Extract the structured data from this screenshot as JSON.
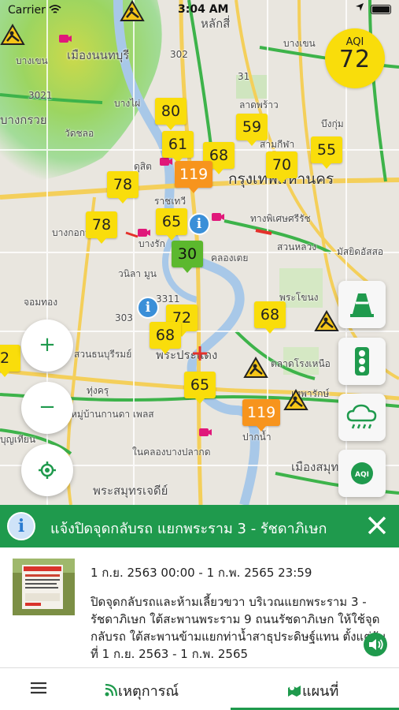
{
  "status_bar": {
    "carrier": "Carrier",
    "time": "3:04 AM"
  },
  "aqi_overall": {
    "label": "AQI",
    "value": "72",
    "color": "#f9dd0b"
  },
  "aqi_markers": [
    "80",
    "59",
    "61",
    "68",
    "55",
    "70",
    "119",
    "78",
    "65",
    "78",
    "30",
    "72",
    "68",
    "68",
    "65",
    "119"
  ],
  "map_labels": {
    "area_1": "หลักสี่",
    "area_2": "เมืองนนทบุรี",
    "area_3": "บางเขน",
    "area_4": "บางกรวย",
    "area_5": "วัดชลอ",
    "area_6": "บางไผ่",
    "area_7": "ลาดพร้าว",
    "area_8": "บึงกุ่ม",
    "area_9": "สามกีฬา",
    "area_10": "ดุสิต",
    "area_11": "กรุงเทพมหานคร",
    "area_12": "ราชเทวี",
    "area_13": "บางกอกน้อย",
    "area_14": "สวนหลวง",
    "area_15": "มัสยิดอัสสอ",
    "area_16": "คลองเตย",
    "area_17": "วนิลา มูน",
    "area_18": "บางรัก",
    "area_19": "พระโขนง",
    "area_20": "จอมทอง",
    "area_21": "สวนธนบุรีรมย์",
    "area_22": "พระประแดง",
    "area_23": "ตลาดโรงเหนือ",
    "area_24": "ทุ่งครุ",
    "area_25": "หมู่บ้านกานดา เพลส",
    "area_26": "บุญเทียน",
    "area_27": "ในคลองบางปลากด",
    "area_28": "ปากน้ำ",
    "area_29": "เมืองสมุทร",
    "area_30": "พระสมุทรเจดีย์",
    "area_31": "ทางพิเศษศรีรัช",
    "area_32": "เทพารักษ์",
    "road_1": "3021",
    "road_2": "302",
    "road_3": "3311",
    "road_4": "303",
    "road_5": "31"
  },
  "map_controls": {
    "zoom_in": "+",
    "zoom_out": "−"
  },
  "banner": {
    "title": "แจ้งปิดจุดกลับรถ แยกพระราม 3 - รัชดาภิเษก"
  },
  "details": {
    "date_range": "1 ก.ย. 2563 00:00 - 1 ก.พ. 2565 23:59",
    "description": "ปิดจุดกลับรถและห้ามเลี้ยวขวา บริเวณแยกพระราม 3 - รัชดาภิเษก ใต้สะพานพระราม 9 ถนนรัชดาภิเษก ให้ใช้จุดกลับรถ ใต้สะพานข้ามแยกท่าน้ำสาธุประดิษฐ์แทน ตั้งแต่วันที่ 1 ก.ย. 2563 - 1 ก.พ. 2565"
  },
  "tabs": {
    "events": "เหตุการณ์",
    "map": "แผนที่"
  },
  "colors": {
    "primary": "#1f9a4d",
    "aqi_moderate": "#f9dd0b",
    "aqi_unhealthy": "#f7941d",
    "aqi_good": "#5cb82e"
  }
}
